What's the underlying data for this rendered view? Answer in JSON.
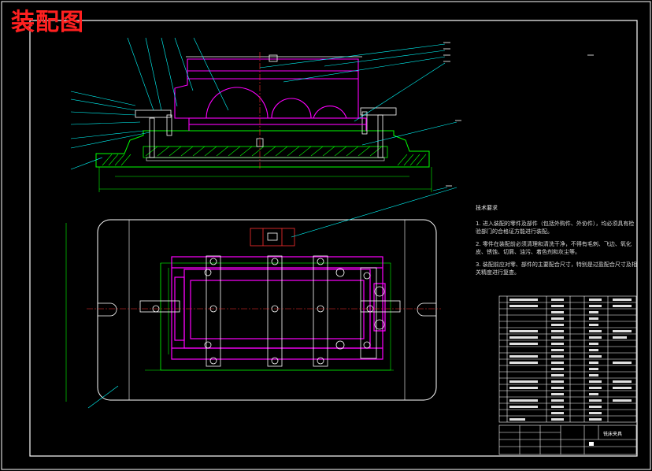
{
  "drawing": {
    "title": "装配图",
    "colors": {
      "background": "#000000",
      "frame": "#ffffff",
      "outline": "#00ff00",
      "component": "#ff00ff",
      "leader": "#00ffff",
      "centerline": "#ff3030",
      "title_text": "#ff2020"
    },
    "technical_requirements": {
      "heading": "技术要求",
      "items": [
        "1. 进入装配的零件及部件（包括外购件、外协件），均必须具有检验部门的合格证方能进行装配。",
        "2. 零件在装配前必须清理和清洗干净，不得有毛刺、飞边、氧化皮、锈蚀、切屑、油污、着色剂和灰尘等。",
        "3. 装配前应对零、部件的主要配合尺寸，特别是过盈配合尺寸及相关精度进行复查。"
      ]
    },
    "title_block": {
      "drawing_name": "铣床夹具"
    }
  }
}
